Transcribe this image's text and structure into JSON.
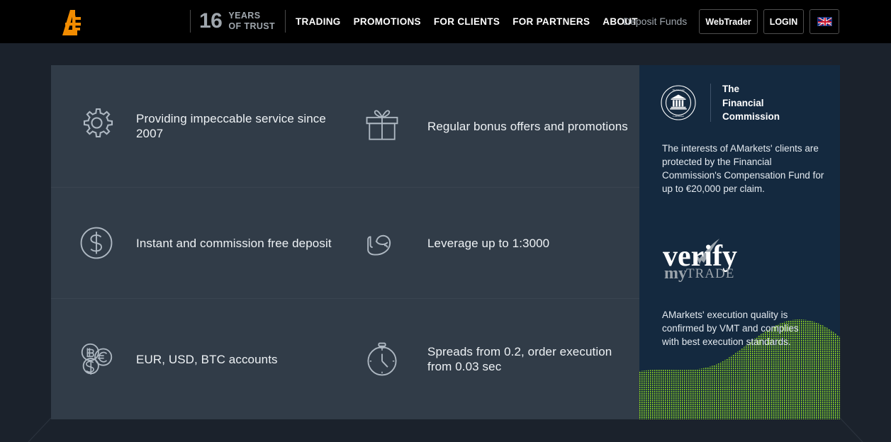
{
  "header": {
    "logo_alt": "AMarkets logo",
    "years_number": "16",
    "years_line1": "YEARS",
    "years_line2": "OF TRUST",
    "nav": [
      {
        "label": "TRADING"
      },
      {
        "label": "PROMOTIONS"
      },
      {
        "label": "FOR CLIENTS"
      },
      {
        "label": "FOR PARTNERS"
      },
      {
        "label": "ABOUT"
      }
    ],
    "deposit_funds": "Deposit Funds",
    "webtrader": "WebTrader",
    "login": "LOGIN",
    "language": "EN"
  },
  "features": [
    {
      "icon": "gear-icon",
      "text": "Providing impeccable service since 2007"
    },
    {
      "icon": "gift-icon",
      "text": "Regular bonus offers and promotions"
    },
    {
      "icon": "dollar-circle-icon",
      "text": "Instant and commission free deposit"
    },
    {
      "icon": "muscle-arm-icon",
      "text": "Leverage up to 1:3000"
    },
    {
      "icon": "coins-icon",
      "text": "EUR, USD, BTC accounts"
    },
    {
      "icon": "stopwatch-icon",
      "text": "Spreads from 0.2, order execution from 0.03 sec"
    }
  ],
  "panel": {
    "fc_title": "The\nFinancial\nCommission",
    "fc_title_line1": "The",
    "fc_title_line2": "Financial",
    "fc_title_line3": "Commission",
    "fc_seal_text_top": "The Financial",
    "fc_seal_text_bottom": "Commission",
    "fc_paragraph": "The interests of AMarkets' clients are protected by the Financial Commission's Compensation Fund for up to €20,000 per claim.",
    "vmt_logo_main": "verify",
    "vmt_logo_sub1": "my",
    "vmt_logo_sub2": "TRADE",
    "vmt_paragraph": "AMarkets' execution quality is confirmed by VMT and complies with best execution standards."
  },
  "colors": {
    "page_background": "#1b222c",
    "header_background": "#000000",
    "card_background": "#313c48",
    "panel_background": "#14293f",
    "logo_orange": "#f28c00",
    "wave_green": "#8bd124",
    "muted_text": "#9fa6ad",
    "body_text": "#eef2f5"
  }
}
